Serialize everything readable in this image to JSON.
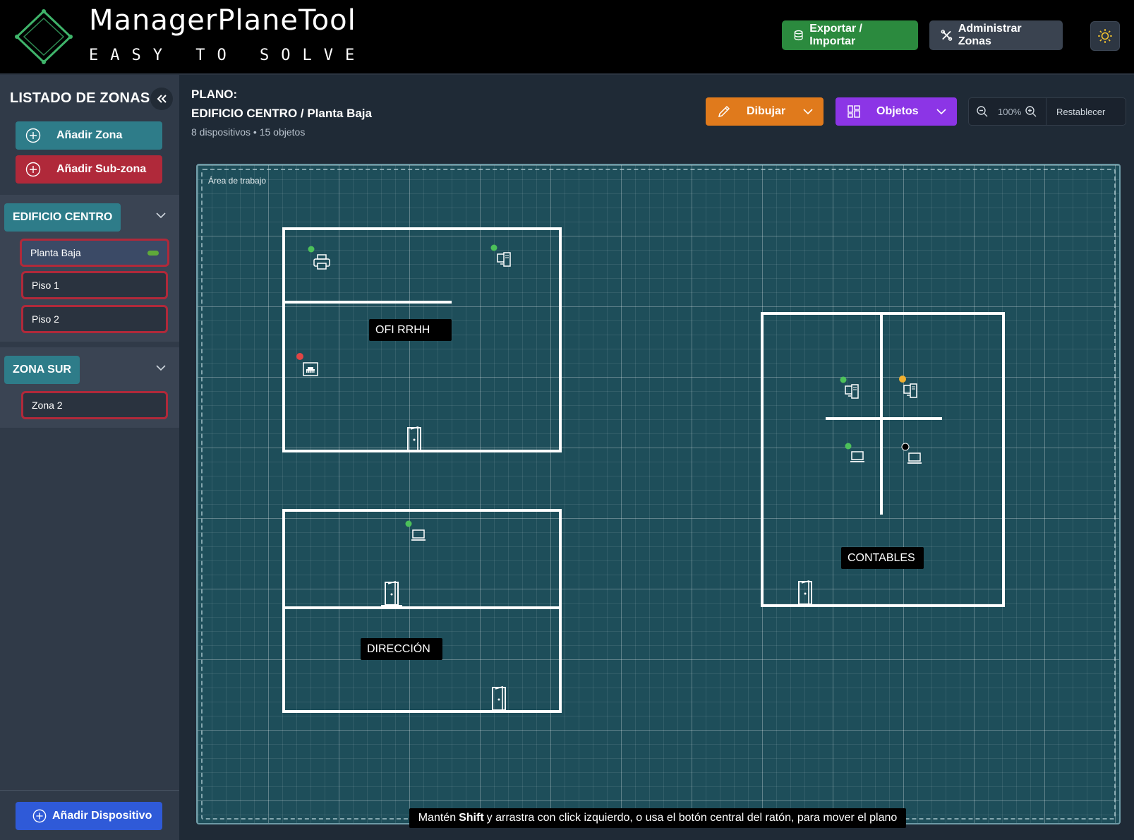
{
  "app": {
    "title": "ManagerPlaneTool",
    "subtitle": "EASY TO SOLVE",
    "export_label": "Exportar / Importar",
    "manage_zones_label": "Administrar Zonas"
  },
  "sidebar": {
    "title": "LISTADO DE ZONAS",
    "add_zone_label": "Añadir Zona",
    "add_subzone_label": "Añadir Sub-zona",
    "zones": [
      {
        "name": "EDIFICIO CENTRO",
        "subzones": [
          {
            "name": "Planta Baja",
            "active": true
          },
          {
            "name": "Piso 1"
          },
          {
            "name": "Piso 2"
          }
        ]
      },
      {
        "name": "ZONA SUR",
        "subzones": [
          {
            "name": "Zona 2"
          }
        ]
      }
    ],
    "add_device_label": "Añadir Dispositivo"
  },
  "toolbar": {
    "plano_label": "PLANO:",
    "plano_name": "EDIFICIO CENTRO / Planta Baja",
    "meta": "8 dispositivos • 15 objetos",
    "draw_label": "Dibujar",
    "objects_label": "Objetos",
    "zoom": "100%",
    "reset_label": "Restablecer"
  },
  "canvas": {
    "area_label": "Área de trabajo",
    "rooms": [
      "OFI RRHH",
      "DIRECCIÓN",
      "CONTABLES"
    ],
    "devices": [
      {
        "type": "printer-icon",
        "status": "green"
      },
      {
        "type": "desktop-icon",
        "status": "green"
      },
      {
        "type": "switch-icon",
        "status": "red"
      },
      {
        "type": "laptop-icon",
        "status": "green"
      },
      {
        "type": "desktop-icon",
        "status": "green"
      },
      {
        "type": "desktop-icon",
        "status": "yellow"
      },
      {
        "type": "laptop-icon",
        "status": "green"
      },
      {
        "type": "laptop-icon",
        "status": "black"
      }
    ],
    "hint_prefix": "Mantén",
    "hint_key": "Shift",
    "hint_suffix": "y arrastra con click izquierdo, o usa el botón central del ratón, para mover el plano"
  },
  "colors": {
    "teal": "#2e7c89",
    "red": "#b0293a",
    "green": "#2b8a3e",
    "orange": "#e07a1c",
    "purple": "#8c35e6",
    "blue": "#2f5ad8",
    "status_green": "#4cc15a",
    "status_red": "#e04545",
    "status_yellow": "#f0b030"
  }
}
